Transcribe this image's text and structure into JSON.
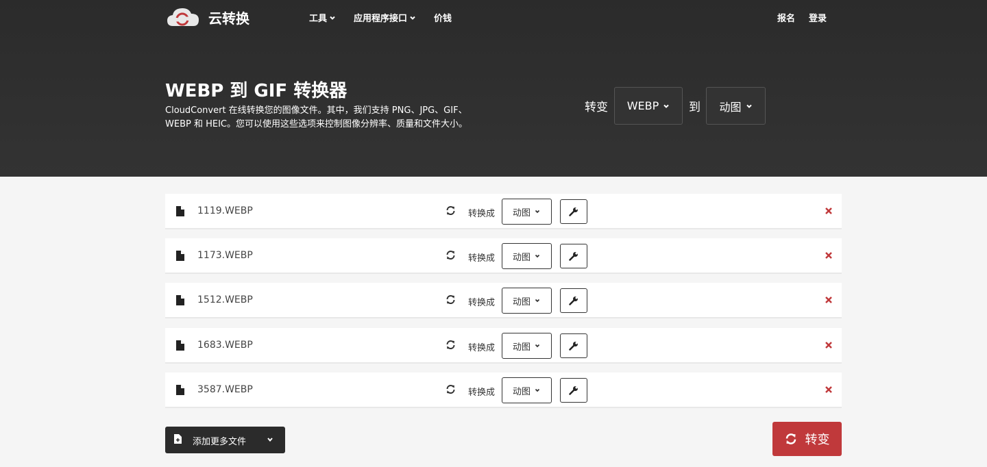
{
  "header": {
    "brand": "云转换",
    "nav": [
      {
        "label": "工具",
        "has_dropdown": true
      },
      {
        "label": "应用程序接口",
        "has_dropdown": true
      },
      {
        "label": "价钱",
        "has_dropdown": false
      }
    ],
    "signup": "报名",
    "login": "登录"
  },
  "hero": {
    "title": "WEBP 到 GIF 转换器",
    "description": "CloudConvert 在线转换您的图像文件。其中，我们支持 PNG、JPG、GIF、WEBP 和 HEIC。您可以使用这些选项来控制图像分辨率、质量和文件大小。",
    "convert_label": "转变",
    "to_label": "到",
    "from_format": "WEBP",
    "to_format": "动图"
  },
  "files": [
    {
      "name": "1119.WEBP",
      "convert_label": "转换成",
      "format": "动图"
    },
    {
      "name": "1173.WEBP",
      "convert_label": "转换成",
      "format": "动图"
    },
    {
      "name": "1512.WEBP",
      "convert_label": "转换成",
      "format": "动图"
    },
    {
      "name": "1683.WEBP",
      "convert_label": "转换成",
      "format": "动图"
    },
    {
      "name": "3587.WEBP",
      "convert_label": "转换成",
      "format": "动图"
    }
  ],
  "actions": {
    "add_more": "添加更多文件",
    "convert": "转变"
  },
  "colors": {
    "hero_bg": "#2b2b2b",
    "accent_red": "#c0393b",
    "remove_red": "#c0393b"
  },
  "icons": [
    "cloud-logo-icon",
    "chevron-down-icon",
    "file-icon",
    "refresh-icon",
    "wrench-icon",
    "close-icon",
    "file-add-icon"
  ]
}
